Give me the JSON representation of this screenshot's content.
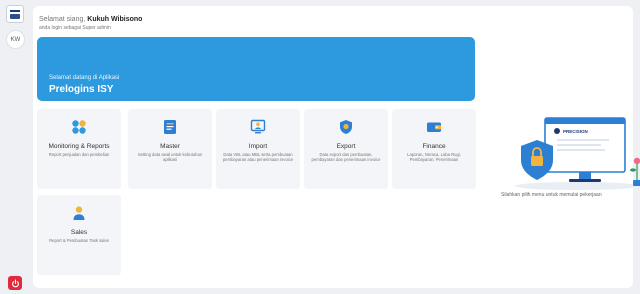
{
  "sidebar": {
    "avatar_initials": "KW"
  },
  "header": {
    "greeting_prefix": "Selamat siang,",
    "user_name": "Kukuh Wibisono",
    "role_line": "anda login sebagai Super admin"
  },
  "banner": {
    "welcome": "Selamat datang di Aplikasi",
    "app_name": "Prelogins ISY",
    "color": "#2d9ae0"
  },
  "cards": [
    {
      "title": "Monitoring & Reports",
      "desc": "Report penjualan dan pembelian",
      "icon": "grid-icon"
    },
    {
      "title": "Master",
      "desc": "Setting data awal untuk kebutuhan aplikasi",
      "icon": "document-icon"
    },
    {
      "title": "Import",
      "desc": "Data VBL atau MBL serta pembuatan pembayaran atau penerimaan invoice",
      "icon": "monitor-user-icon"
    },
    {
      "title": "Export",
      "desc": "Data export dan pembuatan, pembayaran dan penerimaan invoice",
      "icon": "shield-icon"
    },
    {
      "title": "Finance",
      "desc": "Laporan, Neraca, Laba Rugi, Pembayaran, Penerimaan",
      "icon": "wallet-icon"
    },
    {
      "title": "Sales",
      "desc": "Report & Pembuatan Task sales",
      "icon": "user-icon"
    }
  ],
  "illustration": {
    "brand_text": "PRECISION"
  },
  "hint": "Silahkan pilih menu untuk memulai pekerjaan",
  "colors": {
    "accent": "#2d9ae0",
    "danger": "#e02b3c"
  }
}
